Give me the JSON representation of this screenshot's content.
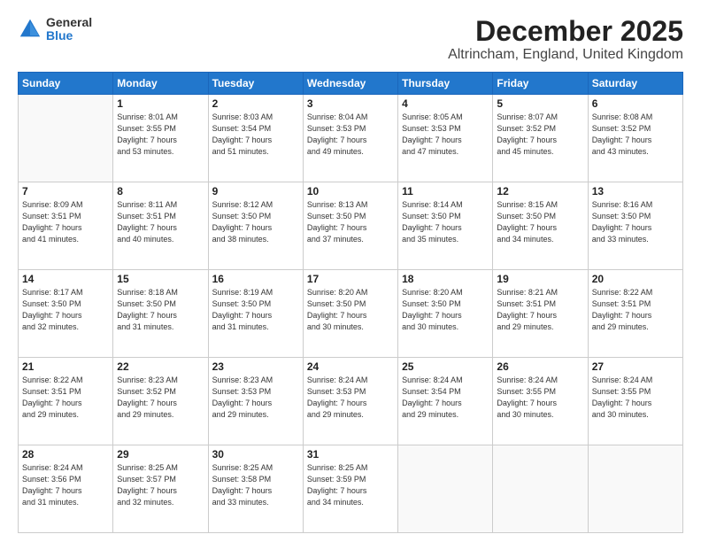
{
  "logo": {
    "general": "General",
    "blue": "Blue"
  },
  "header": {
    "month": "December 2025",
    "location": "Altrincham, England, United Kingdom"
  },
  "weekdays": [
    "Sunday",
    "Monday",
    "Tuesday",
    "Wednesday",
    "Thursday",
    "Friday",
    "Saturday"
  ],
  "weeks": [
    [
      {
        "day": "",
        "info": ""
      },
      {
        "day": "1",
        "info": "Sunrise: 8:01 AM\nSunset: 3:55 PM\nDaylight: 7 hours\nand 53 minutes."
      },
      {
        "day": "2",
        "info": "Sunrise: 8:03 AM\nSunset: 3:54 PM\nDaylight: 7 hours\nand 51 minutes."
      },
      {
        "day": "3",
        "info": "Sunrise: 8:04 AM\nSunset: 3:53 PM\nDaylight: 7 hours\nand 49 minutes."
      },
      {
        "day": "4",
        "info": "Sunrise: 8:05 AM\nSunset: 3:53 PM\nDaylight: 7 hours\nand 47 minutes."
      },
      {
        "day": "5",
        "info": "Sunrise: 8:07 AM\nSunset: 3:52 PM\nDaylight: 7 hours\nand 45 minutes."
      },
      {
        "day": "6",
        "info": "Sunrise: 8:08 AM\nSunset: 3:52 PM\nDaylight: 7 hours\nand 43 minutes."
      }
    ],
    [
      {
        "day": "7",
        "info": "Sunrise: 8:09 AM\nSunset: 3:51 PM\nDaylight: 7 hours\nand 41 minutes."
      },
      {
        "day": "8",
        "info": "Sunrise: 8:11 AM\nSunset: 3:51 PM\nDaylight: 7 hours\nand 40 minutes."
      },
      {
        "day": "9",
        "info": "Sunrise: 8:12 AM\nSunset: 3:50 PM\nDaylight: 7 hours\nand 38 minutes."
      },
      {
        "day": "10",
        "info": "Sunrise: 8:13 AM\nSunset: 3:50 PM\nDaylight: 7 hours\nand 37 minutes."
      },
      {
        "day": "11",
        "info": "Sunrise: 8:14 AM\nSunset: 3:50 PM\nDaylight: 7 hours\nand 35 minutes."
      },
      {
        "day": "12",
        "info": "Sunrise: 8:15 AM\nSunset: 3:50 PM\nDaylight: 7 hours\nand 34 minutes."
      },
      {
        "day": "13",
        "info": "Sunrise: 8:16 AM\nSunset: 3:50 PM\nDaylight: 7 hours\nand 33 minutes."
      }
    ],
    [
      {
        "day": "14",
        "info": "Sunrise: 8:17 AM\nSunset: 3:50 PM\nDaylight: 7 hours\nand 32 minutes."
      },
      {
        "day": "15",
        "info": "Sunrise: 8:18 AM\nSunset: 3:50 PM\nDaylight: 7 hours\nand 31 minutes."
      },
      {
        "day": "16",
        "info": "Sunrise: 8:19 AM\nSunset: 3:50 PM\nDaylight: 7 hours\nand 31 minutes."
      },
      {
        "day": "17",
        "info": "Sunrise: 8:20 AM\nSunset: 3:50 PM\nDaylight: 7 hours\nand 30 minutes."
      },
      {
        "day": "18",
        "info": "Sunrise: 8:20 AM\nSunset: 3:50 PM\nDaylight: 7 hours\nand 30 minutes."
      },
      {
        "day": "19",
        "info": "Sunrise: 8:21 AM\nSunset: 3:51 PM\nDaylight: 7 hours\nand 29 minutes."
      },
      {
        "day": "20",
        "info": "Sunrise: 8:22 AM\nSunset: 3:51 PM\nDaylight: 7 hours\nand 29 minutes."
      }
    ],
    [
      {
        "day": "21",
        "info": "Sunrise: 8:22 AM\nSunset: 3:51 PM\nDaylight: 7 hours\nand 29 minutes."
      },
      {
        "day": "22",
        "info": "Sunrise: 8:23 AM\nSunset: 3:52 PM\nDaylight: 7 hours\nand 29 minutes."
      },
      {
        "day": "23",
        "info": "Sunrise: 8:23 AM\nSunset: 3:53 PM\nDaylight: 7 hours\nand 29 minutes."
      },
      {
        "day": "24",
        "info": "Sunrise: 8:24 AM\nSunset: 3:53 PM\nDaylight: 7 hours\nand 29 minutes."
      },
      {
        "day": "25",
        "info": "Sunrise: 8:24 AM\nSunset: 3:54 PM\nDaylight: 7 hours\nand 29 minutes."
      },
      {
        "day": "26",
        "info": "Sunrise: 8:24 AM\nSunset: 3:55 PM\nDaylight: 7 hours\nand 30 minutes."
      },
      {
        "day": "27",
        "info": "Sunrise: 8:24 AM\nSunset: 3:55 PM\nDaylight: 7 hours\nand 30 minutes."
      }
    ],
    [
      {
        "day": "28",
        "info": "Sunrise: 8:24 AM\nSunset: 3:56 PM\nDaylight: 7 hours\nand 31 minutes."
      },
      {
        "day": "29",
        "info": "Sunrise: 8:25 AM\nSunset: 3:57 PM\nDaylight: 7 hours\nand 32 minutes."
      },
      {
        "day": "30",
        "info": "Sunrise: 8:25 AM\nSunset: 3:58 PM\nDaylight: 7 hours\nand 33 minutes."
      },
      {
        "day": "31",
        "info": "Sunrise: 8:25 AM\nSunset: 3:59 PM\nDaylight: 7 hours\nand 34 minutes."
      },
      {
        "day": "",
        "info": ""
      },
      {
        "day": "",
        "info": ""
      },
      {
        "day": "",
        "info": ""
      }
    ]
  ]
}
